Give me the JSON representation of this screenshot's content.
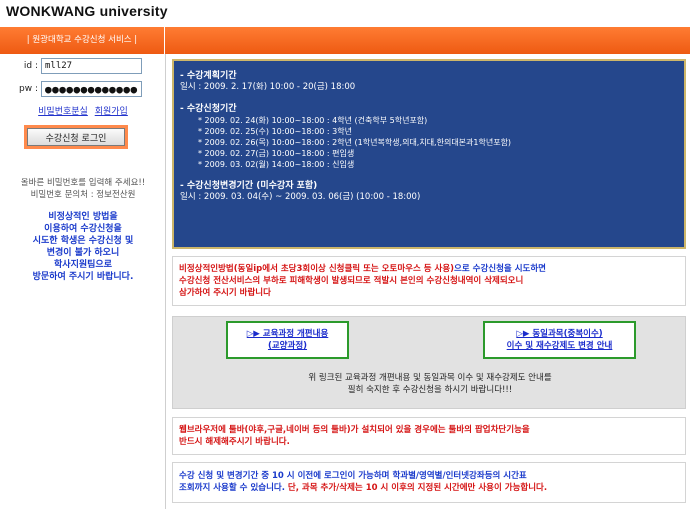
{
  "site": {
    "logo": "WONKWANG university"
  },
  "topbar": {
    "title": "| 원광대학교 수강신청 서비스 |"
  },
  "login": {
    "id_label": "id :",
    "id_value": "mll27",
    "pw_label": "pw :",
    "pw_value": "●●●●●●●●●●●●●",
    "link_lost_pw": "비밀번호분실",
    "link_signup": "회원가입",
    "login_button": "수강신청 로그인"
  },
  "left": {
    "notice_lines": [
      "올바른 비밀번호를 입력해 주세요!!",
      "비밀번호 문의처 : 정보전산원"
    ],
    "warn_lines": [
      "비정상적인 방법을",
      "이용하여 수강신청을",
      "시도한 학생은 수강신청 및",
      "변경이 불가 하오니",
      "학사지원팀으로",
      "방문하여 주시기 바랍니다."
    ]
  },
  "schedule": {
    "plan_title": "- 수강계획기간",
    "plan_date": "일시 : 2009. 2. 17(화) 10:00 - 20(금) 18:00",
    "reg_title": "- 수강신청기간",
    "reg_items": [
      "* 2009. 02. 24(화) 10:00~18:00 : 4학년 (건축학부 5학년포함)",
      "* 2009. 02. 25(수) 10:00~18:00 : 3학년",
      "* 2009. 02. 26(목) 10:00~18:00 : 2학년 (1학년복학생,의대,치대,한의대본과1학년포함)",
      "* 2009. 02. 27(금) 10:00~18:00 : 편입생",
      "* 2009. 03. 02(월) 14:00~18:00 : 신입생"
    ],
    "change_title": "- 수강신청변경기간 (미수강자 포함)",
    "change_date": "일시 : 2009. 03. 04(수) ~ 2009. 03. 06(금) (10:00 - 18:00)"
  },
  "warning": {
    "red_part": "비정상적인방법(동일ip에서 초당3회이상 신청클릭 또는 오토마우스 등 사용)",
    "blue_part": "으로 수강신청을 시도하면",
    "line2": "수강신청 전산서비스의 부하로 피해학생이 발생되므로 적발시 본인의 수강신청내역이 삭제되오니",
    "line3": "삼가하여 주시기 바랍니다"
  },
  "links": {
    "curriculum_line1": "▷▶ 교육과정 개편내용",
    "curriculum_line2": "(교양과정)",
    "same_course_line1": "▷▶ 동일과목(중복이수)",
    "same_course_line2": "이수 및 재수강제도 변경 안내",
    "guide_line1": "위 링크된 교육과정 개편내용 및 동일과목 이수 및 재수강제도 안내를",
    "guide_line2": "필히 숙지한 후 수강신청을 하시기 바랍니다!!!"
  },
  "toolbar_notice": {
    "line1": "웹브라우저에 툴바(야후,구글,네이버 등의 툴바)가 설치되어 있을 경우에는 툴바의 팝업차단기능을",
    "line2": "반드시 해제해주시기 바랍니다."
  },
  "login_time": {
    "line1": "수강 신청 및 변경기간 중 10 시 이전에 로그인이 가능하며 학과별/영역별/인터넷강좌등의 시간표",
    "line2_blue": "조회까지 사용할 수 있습니다. ",
    "line2_red": "단, 과목 추가/삭제는 10 시 이후의 지정된 시간에만 사용이 가능합니다."
  }
}
